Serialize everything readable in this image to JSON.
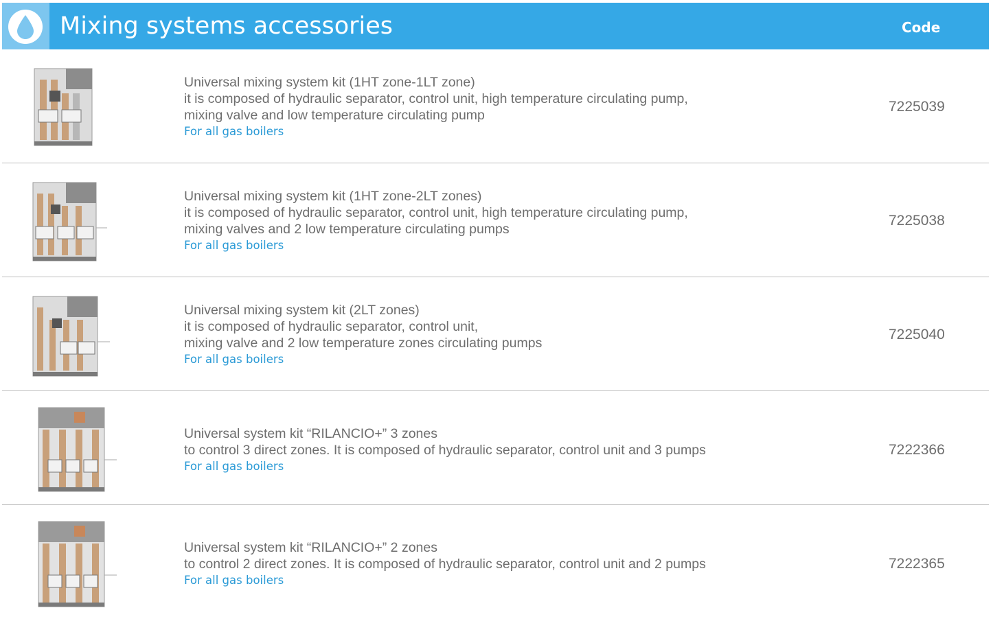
{
  "header": {
    "icon": "water-drop-icon",
    "title": "Mixing systems accessories",
    "code_label": "Code"
  },
  "colors": {
    "header_bar": "#35a8e6",
    "icon_box": "#7dc6ef",
    "note_text": "#2a9ad6",
    "body_text": "#6e6e6e"
  },
  "products": [
    {
      "image": "mixing-kit-1ht-1lt-image",
      "name": "Universal mixing system kit (1HT zone-1LT zone)",
      "description": [
        "it is composed of hydraulic separator, control unit, high temperature circulating pump,",
        "mixing valve and low temperature circulating pump"
      ],
      "note": "For all gas boilers",
      "code": "7225039"
    },
    {
      "image": "mixing-kit-1ht-2lt-image",
      "name": "Universal mixing system kit (1HT zone-2LT zones)",
      "description": [
        "it is composed of hydraulic separator, control unit, high temperature circulating pump,",
        "mixing valves and 2 low temperature circulating pumps"
      ],
      "note": "For all gas boilers",
      "code": "7225038"
    },
    {
      "image": "mixing-kit-2lt-image",
      "name": "Universal mixing system kit (2LT zones)",
      "description": [
        "it is composed of hydraulic separator, control unit,",
        "mixing valve and 2 low temperature zones circulating pumps"
      ],
      "note": "For all gas boilers",
      "code": "7225040"
    },
    {
      "image": "rilancio-3-zones-image",
      "name": "Universal system kit “RILANCIO+” 3 zones",
      "description": [
        "to control 3 direct zones. It is composed of hydraulic separator, control unit and 3 pumps"
      ],
      "note": "For all gas boilers",
      "code": "7222366"
    },
    {
      "image": "rilancio-2-zones-image",
      "name": "Universal system kit “RILANCIO+” 2 zones",
      "description": [
        "to control 2 direct zones. It is composed of hydraulic separator, control unit and 2 pumps"
      ],
      "note": "For all gas boilers",
      "code": "7222365"
    }
  ]
}
